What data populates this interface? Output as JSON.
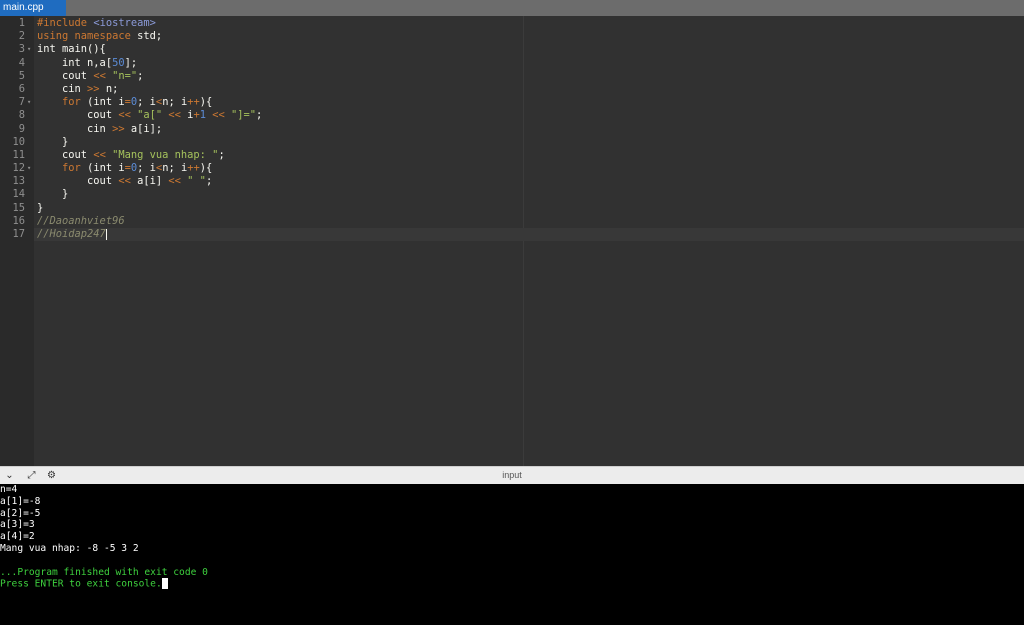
{
  "tab": {
    "label": "main.cpp"
  },
  "editor": {
    "line_numbers": [
      "1",
      "2",
      "3",
      "4",
      "5",
      "6",
      "7",
      "8",
      "9",
      "10",
      "11",
      "12",
      "13",
      "14",
      "15",
      "16",
      "17"
    ],
    "lines": [
      [
        {
          "t": "pre",
          "v": "#include "
        },
        {
          "t": "hdr",
          "v": "<iostream>"
        }
      ],
      [
        {
          "t": "kw",
          "v": "using namespace"
        },
        {
          "t": "plain",
          "v": " std;"
        }
      ],
      [
        {
          "t": "plain",
          "v": "int main(){"
        }
      ],
      [
        {
          "t": "plain",
          "v": "    int n,a["
        },
        {
          "t": "num",
          "v": "50"
        },
        {
          "t": "plain",
          "v": "];"
        }
      ],
      [
        {
          "t": "plain",
          "v": "    cout "
        },
        {
          "t": "op",
          "v": "<<"
        },
        {
          "t": "plain",
          "v": " "
        },
        {
          "t": "str",
          "v": "\"n=\""
        },
        {
          "t": "plain",
          "v": ";"
        }
      ],
      [
        {
          "t": "plain",
          "v": "    cin "
        },
        {
          "t": "op",
          "v": ">>"
        },
        {
          "t": "plain",
          "v": " n;"
        }
      ],
      [
        {
          "t": "plain",
          "v": "    "
        },
        {
          "t": "kw",
          "v": "for"
        },
        {
          "t": "plain",
          "v": " (int i"
        },
        {
          "t": "op",
          "v": "="
        },
        {
          "t": "num",
          "v": "0"
        },
        {
          "t": "plain",
          "v": "; i"
        },
        {
          "t": "op",
          "v": "<"
        },
        {
          "t": "plain",
          "v": "n; i"
        },
        {
          "t": "op",
          "v": "++"
        },
        {
          "t": "plain",
          "v": "){"
        }
      ],
      [
        {
          "t": "plain",
          "v": "        cout "
        },
        {
          "t": "op",
          "v": "<<"
        },
        {
          "t": "plain",
          "v": " "
        },
        {
          "t": "str",
          "v": "\"a[\""
        },
        {
          "t": "plain",
          "v": " "
        },
        {
          "t": "op",
          "v": "<<"
        },
        {
          "t": "plain",
          "v": " i"
        },
        {
          "t": "op",
          "v": "+"
        },
        {
          "t": "num",
          "v": "1"
        },
        {
          "t": "plain",
          "v": " "
        },
        {
          "t": "op",
          "v": "<<"
        },
        {
          "t": "plain",
          "v": " "
        },
        {
          "t": "str",
          "v": "\"]=\""
        },
        {
          "t": "plain",
          "v": ";"
        }
      ],
      [
        {
          "t": "plain",
          "v": "        cin "
        },
        {
          "t": "op",
          "v": ">>"
        },
        {
          "t": "plain",
          "v": " a[i];"
        }
      ],
      [
        {
          "t": "plain",
          "v": "    }"
        }
      ],
      [
        {
          "t": "plain",
          "v": "    cout "
        },
        {
          "t": "op",
          "v": "<<"
        },
        {
          "t": "plain",
          "v": " "
        },
        {
          "t": "str",
          "v": "\"Mang vua nhap: \""
        },
        {
          "t": "plain",
          "v": ";"
        }
      ],
      [
        {
          "t": "plain",
          "v": "    "
        },
        {
          "t": "kw",
          "v": "for"
        },
        {
          "t": "plain",
          "v": " (int i"
        },
        {
          "t": "op",
          "v": "="
        },
        {
          "t": "num",
          "v": "0"
        },
        {
          "t": "plain",
          "v": "; i"
        },
        {
          "t": "op",
          "v": "<"
        },
        {
          "t": "plain",
          "v": "n; i"
        },
        {
          "t": "op",
          "v": "++"
        },
        {
          "t": "plain",
          "v": "){"
        }
      ],
      [
        {
          "t": "plain",
          "v": "        cout "
        },
        {
          "t": "op",
          "v": "<<"
        },
        {
          "t": "plain",
          "v": " a[i] "
        },
        {
          "t": "op",
          "v": "<<"
        },
        {
          "t": "plain",
          "v": " "
        },
        {
          "t": "str",
          "v": "\" \""
        },
        {
          "t": "plain",
          "v": ";"
        }
      ],
      [
        {
          "t": "plain",
          "v": "    }"
        }
      ],
      [
        {
          "t": "plain",
          "v": "}"
        }
      ],
      [
        {
          "t": "cmt",
          "v": "//Daoanhviet96"
        }
      ],
      [
        {
          "t": "cmt",
          "v": "//Hoidap247"
        }
      ]
    ],
    "fold_lines": [
      "3",
      "7",
      "12"
    ],
    "fold_icon": "fold-arrow-icon"
  },
  "console_bar": {
    "title": "input",
    "icons": [
      "chevron-down-icon",
      "expand-icon",
      "settings-icon"
    ]
  },
  "console": {
    "lines": [
      {
        "text": "n=4",
        "color": "white"
      },
      {
        "text": "a[1]=-8",
        "color": "white"
      },
      {
        "text": "a[2]=-5",
        "color": "white"
      },
      {
        "text": "a[3]=3",
        "color": "white"
      },
      {
        "text": "a[4]=2",
        "color": "white"
      },
      {
        "text": "Mang vua nhap: -8 -5 3 2",
        "color": "white"
      },
      {
        "text": "",
        "color": "white"
      },
      {
        "text": "...Program finished with exit code 0",
        "color": "green"
      },
      {
        "text": "Press ENTER to exit console.",
        "color": "green"
      }
    ]
  },
  "colors": {
    "tab_active": "#1f6cc0",
    "editor_bg": "#313131",
    "console_bg": "#000000",
    "console_green": "#3ed13e"
  }
}
